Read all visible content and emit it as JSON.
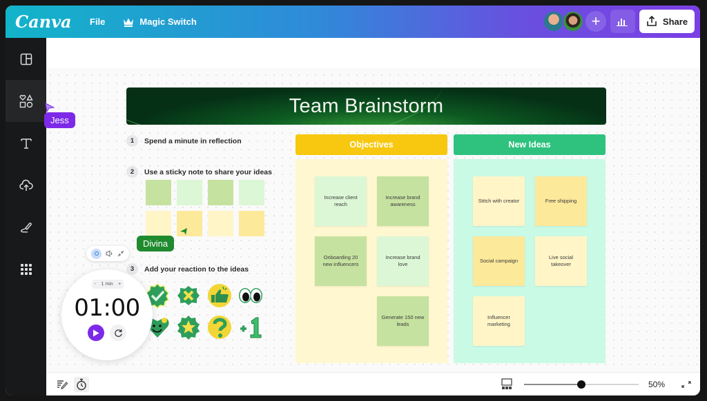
{
  "app": {
    "logo": "Canva",
    "menu": {
      "file": "File",
      "magic_switch": "Magic Switch"
    },
    "share_label": "Share",
    "collaborators": [
      "avatar-1",
      "avatar-2"
    ],
    "colors": {
      "accent_purple": "#7d2ae8",
      "objectives": "#f7c80f",
      "new_ideas": "#2ec27e"
    }
  },
  "sidebar": {
    "items": [
      {
        "name": "design",
        "icon": "layout-icon"
      },
      {
        "name": "elements",
        "icon": "shapes-icon",
        "active": true
      },
      {
        "name": "text",
        "icon": "text-icon"
      },
      {
        "name": "uploads",
        "icon": "cloud-upload-icon"
      },
      {
        "name": "draw",
        "icon": "draw-icon"
      },
      {
        "name": "apps",
        "icon": "apps-grid-icon"
      }
    ]
  },
  "board": {
    "title": "Team Brainstorm",
    "steps": [
      {
        "num": "1",
        "text": "Spend a minute in reflection"
      },
      {
        "num": "2",
        "text": "Use a sticky note to share your ideas"
      },
      {
        "num": "3",
        "text": "Add your reaction to the ideas"
      }
    ],
    "sticky_palette": [
      "#c6e2a0",
      "#dcf7d6",
      "#c6e2a0",
      "#dcf7d6",
      "#fff5c7",
      "#fde99a",
      "#fff5c7",
      "#fde99a"
    ],
    "columns": {
      "objectives": {
        "title": "Objectives",
        "notes": [
          {
            "text": "Increase client reach",
            "color": "#dcf7d6"
          },
          {
            "text": "Increase brand awareness",
            "color": "#c6e2a0"
          },
          {
            "text": "Onboarding 20 new influencers",
            "color": "#c6e2a0"
          },
          {
            "text": "Increase brand love",
            "color": "#dcf7d6"
          },
          {
            "text": "Generate 150 new leads",
            "color": "#c6e2a0"
          }
        ]
      },
      "new_ideas": {
        "title": "New Ideas",
        "notes": [
          {
            "text": "Stitch with creator",
            "color": "#fff5c7"
          },
          {
            "text": "Free shipping",
            "color": "#fde99a"
          },
          {
            "text": "Social campaign",
            "color": "#fde99a"
          },
          {
            "text": "Live social takeover",
            "color": "#fff5c7"
          },
          {
            "text": "Influencer marketing",
            "color": "#fff5c7"
          }
        ]
      }
    },
    "reactions": [
      "checkmark-sticker",
      "cross-sticker",
      "thumbs-up-sticker",
      "eyes-sticker",
      "heart-smile-sticker",
      "star-sticker",
      "question-sticker",
      "plus-one-sticker"
    ],
    "cursors": [
      {
        "name": "Jess",
        "color": "#7d2ae8"
      },
      {
        "name": "Divina",
        "color": "#1f8a2e"
      }
    ]
  },
  "timer": {
    "duration_label": "1 min",
    "minus": "-",
    "plus": "+",
    "time": "01:00"
  },
  "footer": {
    "zoom_label": "50%",
    "zoom_fraction": 0.5
  }
}
